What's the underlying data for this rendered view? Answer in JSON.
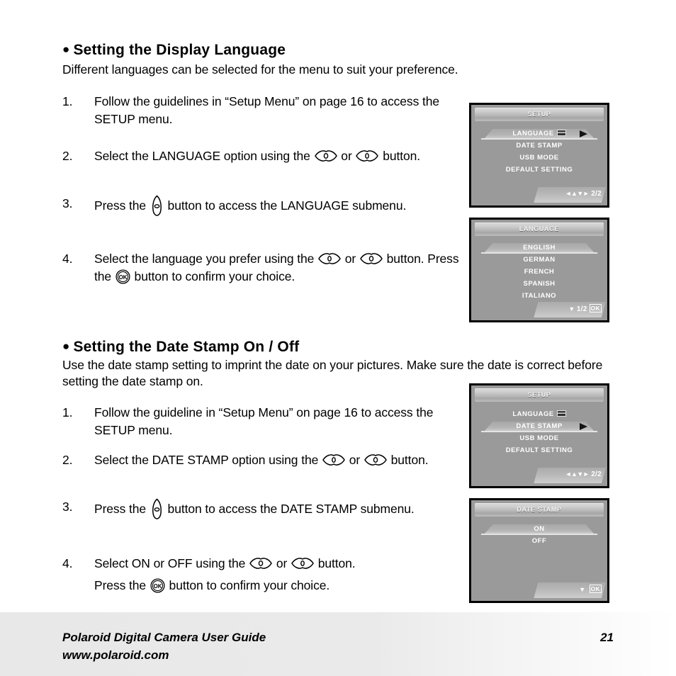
{
  "sections": [
    {
      "heading": "Setting the Display Language",
      "intro": "Different languages can be selected for the menu to suit your preference.",
      "steps": [
        {
          "num": "1.",
          "pre": "Follow the guidelines in “Setup Menu” on page 16 to access the SETUP menu."
        },
        {
          "num": "2.",
          "pre": "Select the LANGUAGE option using the ",
          "mid": " or ",
          "post": " button."
        },
        {
          "num": "3.",
          "pre": "Press the ",
          "post": " button to access the LANGUAGE submenu."
        },
        {
          "num": "4.",
          "pre": "Select the language you prefer using the ",
          "mid": " or ",
          "post": " button. Press the ",
          "tail": " button to confirm your choice."
        }
      ]
    },
    {
      "heading": "Setting the Date Stamp On / Off",
      "intro": "Use the date stamp setting to imprint the date on your pictures. Make sure the date is correct before setting the date stamp on.",
      "steps": [
        {
          "num": "1.",
          "pre": "Follow the guideline in “Setup Menu” on page 16 to access the SETUP menu."
        },
        {
          "num": "2.",
          "pre": "Select the DATE STAMP option using the ",
          "mid": " or ",
          "post": " button."
        },
        {
          "num": "3.",
          "pre": "Press the ",
          "post": " button to access the DATE STAMP submenu."
        },
        {
          "num": "4.",
          "pre": "Select ON or OFF using the ",
          "mid": " or ",
          "post": " button.",
          "tail_pre": "Press the ",
          "tail": " button to confirm your choice."
        }
      ]
    }
  ],
  "screens": [
    {
      "id": "setup-language",
      "title": "SETUP",
      "items": [
        {
          "label": "LANGUAGE",
          "selected": true,
          "flag": true,
          "arrow": true
        },
        {
          "label": "DATE STAMP",
          "selected": false,
          "flag": false,
          "arrow": false
        },
        {
          "label": "USB MODE",
          "selected": false,
          "flag": false,
          "arrow": false
        },
        {
          "label": "DEFAULT SETTING",
          "selected": false,
          "flag": false,
          "arrow": false
        }
      ],
      "nav_arrows": "◄▲▼►",
      "nav_page": "2/2",
      "nav_ok": ""
    },
    {
      "id": "language-submenu",
      "title": "LANGUAGE",
      "items": [
        {
          "label": "ENGLISH",
          "selected": true,
          "flag": false,
          "arrow": false
        },
        {
          "label": "GERMAN",
          "selected": false,
          "flag": false,
          "arrow": false
        },
        {
          "label": "FRENCH",
          "selected": false,
          "flag": false,
          "arrow": false
        },
        {
          "label": "SPANISH",
          "selected": false,
          "flag": false,
          "arrow": false
        },
        {
          "label": "ITALIANO",
          "selected": false,
          "flag": false,
          "arrow": false
        }
      ],
      "nav_arrows": "▼",
      "nav_page": "1/2",
      "nav_ok": "OK"
    },
    {
      "id": "setup-datestamp",
      "title": "SETUP",
      "items": [
        {
          "label": "LANGUAGE",
          "selected": false,
          "flag": true,
          "arrow": false
        },
        {
          "label": "DATE STAMP",
          "selected": true,
          "flag": false,
          "arrow": true
        },
        {
          "label": "USB MODE",
          "selected": false,
          "flag": false,
          "arrow": false
        },
        {
          "label": "DEFAULT SETTING",
          "selected": false,
          "flag": false,
          "arrow": false
        }
      ],
      "nav_arrows": "◄▲▼►",
      "nav_page": "2/2",
      "nav_ok": ""
    },
    {
      "id": "datestamp-submenu",
      "title": "DATE STAMP",
      "items": [
        {
          "label": "ON",
          "selected": true,
          "flag": false,
          "arrow": false
        },
        {
          "label": "OFF",
          "selected": false,
          "flag": false,
          "arrow": false
        }
      ],
      "nav_arrows": "▼",
      "nav_page": "",
      "nav_ok": "OK"
    }
  ],
  "footer": {
    "line1": "Polaroid Digital Camera User Guide",
    "line2": "www.polaroid.com",
    "page": "21"
  },
  "colors": {
    "lcd_background": "#9a9a9a",
    "lcd_text": "#ffffff",
    "page_background": "#ffffff",
    "footer_band": "#e8e8e8"
  }
}
